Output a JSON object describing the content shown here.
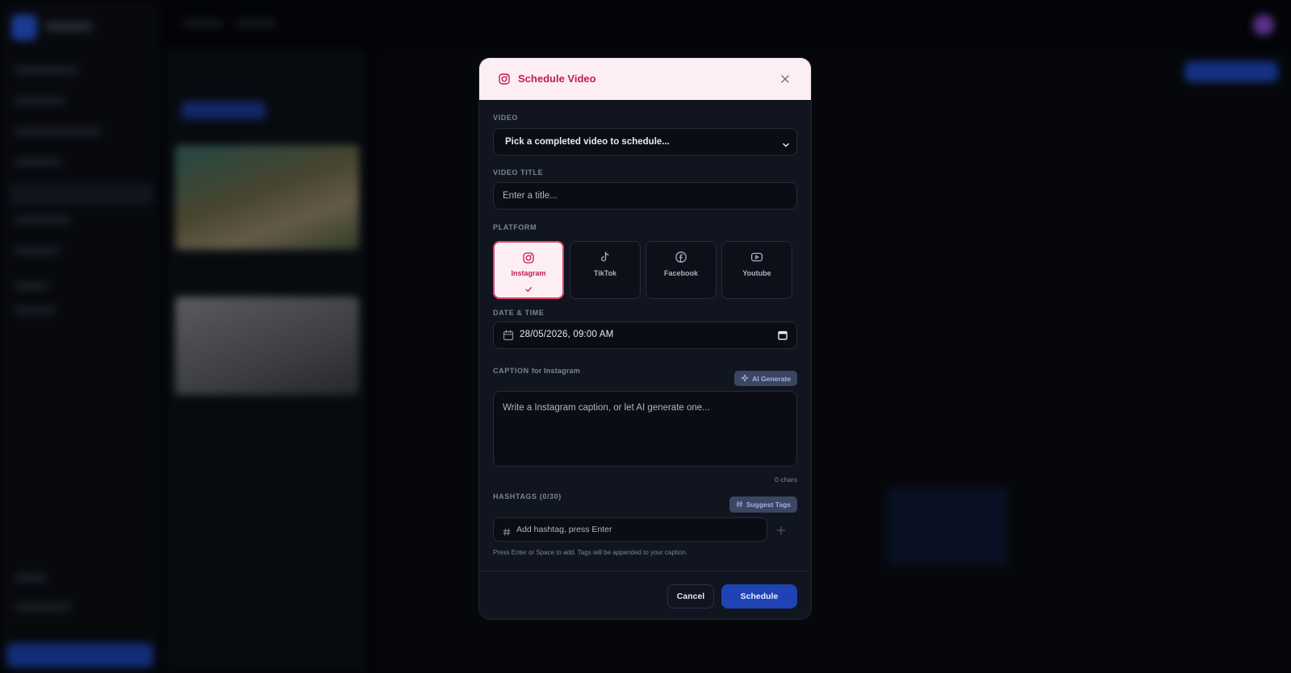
{
  "modal": {
    "title": "Schedule Video",
    "title_icon": "instagram-icon",
    "close_icon": "close-icon",
    "video": {
      "label": "VIDEO",
      "selected": "Pick a completed video to schedule..."
    },
    "video_title": {
      "label": "VIDEO TITLE",
      "placeholder": "Enter a title..."
    },
    "platform": {
      "label": "PLATFORM",
      "options": [
        {
          "label": "Instagram",
          "icon": "instagram-icon",
          "selected": true
        },
        {
          "label": "TikTok",
          "icon": "tiktok-icon",
          "selected": false
        },
        {
          "label": "Facebook",
          "icon": "facebook-icon",
          "selected": false
        },
        {
          "label": "Youtube",
          "icon": "youtube-icon",
          "selected": false
        }
      ]
    },
    "datetime": {
      "label": "DATE & TIME",
      "value": "28/05/2026, 09:00 AM"
    },
    "caption": {
      "label": "CAPTION",
      "label_suffix": "for Instagram",
      "ai_button": "AI Generate",
      "placeholder": "Write a Instagram caption, or let AI generate one...",
      "chars": "0 chars"
    },
    "hashtags": {
      "label": "HASHTAGS",
      "count": "(0/30)",
      "suggest_button": "Suggest Tags",
      "placeholder": "Add hashtag, press Enter",
      "hint": "Press Enter or Space to add. Tags will be appended to your caption."
    },
    "actions": {
      "cancel": "Cancel",
      "schedule": "Schedule"
    }
  },
  "colors": {
    "accent": "#c21d50",
    "primary": "#1f42b5",
    "modal_bg": "#111520",
    "header_bg": "#fdeef3"
  }
}
